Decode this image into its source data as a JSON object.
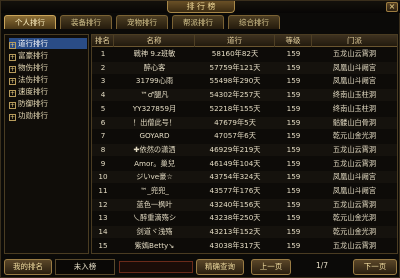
{
  "window": {
    "title": "排 行 榜",
    "close_label": "×"
  },
  "tabs": [
    "个人排行",
    "装备排行",
    "宠物排行",
    "帮派排行",
    "综合排行"
  ],
  "categories": [
    {
      "label": "道行排行",
      "active": true
    },
    {
      "label": "富豪排行",
      "active": false
    },
    {
      "label": "物伤排行",
      "active": false
    },
    {
      "label": "法伤排行",
      "active": false
    },
    {
      "label": "速度排行",
      "active": false
    },
    {
      "label": "防御排行",
      "active": false
    },
    {
      "label": "功勋排行",
      "active": false
    }
  ],
  "table": {
    "headers": [
      "排名",
      "名称",
      "道行",
      "等级",
      "门派"
    ],
    "rows": [
      [
        "1",
        "戰神 9.z班敏",
        "58160年82天",
        "159",
        "五龙山云霄洞"
      ],
      [
        "2",
        "醉心客",
        "57759年121天",
        "159",
        "凤凰山斗阙宫"
      ],
      [
        "3",
        "31799心雨",
        "55498年290天",
        "159",
        "凤凰山斗阙宫"
      ],
      [
        "4",
        "™♂腿凡",
        "54302年257天",
        "159",
        "终南山玉柱洞"
      ],
      [
        "5",
        "YY327859月",
        "52218年155天",
        "159",
        "终南山玉柱洞"
      ],
      [
        "6",
        "！出僧此号！",
        "47679年5天",
        "159",
        "骷髅山白骨洞"
      ],
      [
        "7",
        "GOYARD",
        "47057年6天",
        "159",
        "乾元山金光洞"
      ],
      [
        "8",
        "✚依然の潇洒",
        "46929年219天",
        "159",
        "五龙山云霄洞"
      ],
      [
        "9",
        "Amor。巢兒",
        "46149年104天",
        "159",
        "五龙山云霄洞"
      ],
      [
        "10",
        "ジいve豪☆",
        "43754年324天",
        "159",
        "凤凰山斗阙宫"
      ],
      [
        "11",
        "™_兜兜_",
        "43577年176天",
        "159",
        "凤凰山斗阙宫"
      ],
      [
        "12",
        "蓝色一枫叶",
        "43240年156天",
        "159",
        "五龙山云霄洞"
      ],
      [
        "13",
        "乀醉重滴殇シ",
        "43238年250天",
        "159",
        "乾元山金光洞"
      ],
      [
        "14",
        "剑道ヾ浅殇",
        "43213年152天",
        "159",
        "乾元山金光洞"
      ],
      [
        "15",
        "紫嫣Betty↘",
        "43038年317天",
        "159",
        "五龙山云霄洞"
      ]
    ]
  },
  "footer": {
    "my_rank_label": "我的排名",
    "my_rank_value": "未入榜",
    "search_label": "精确查询",
    "prev_label": "上一页",
    "page_indicator": "1/7",
    "next_label": "下一页"
  }
}
